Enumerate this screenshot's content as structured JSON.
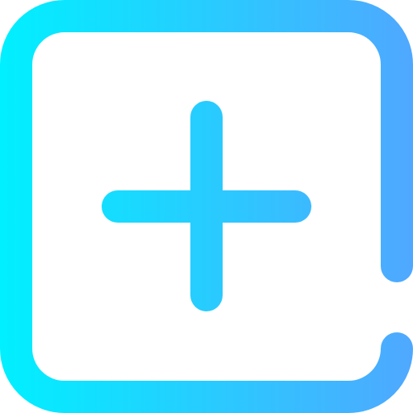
{
  "icon": {
    "name": "add-square-icon",
    "gradient_start": "#00f0ff",
    "gradient_end": "#4fa8ff"
  }
}
